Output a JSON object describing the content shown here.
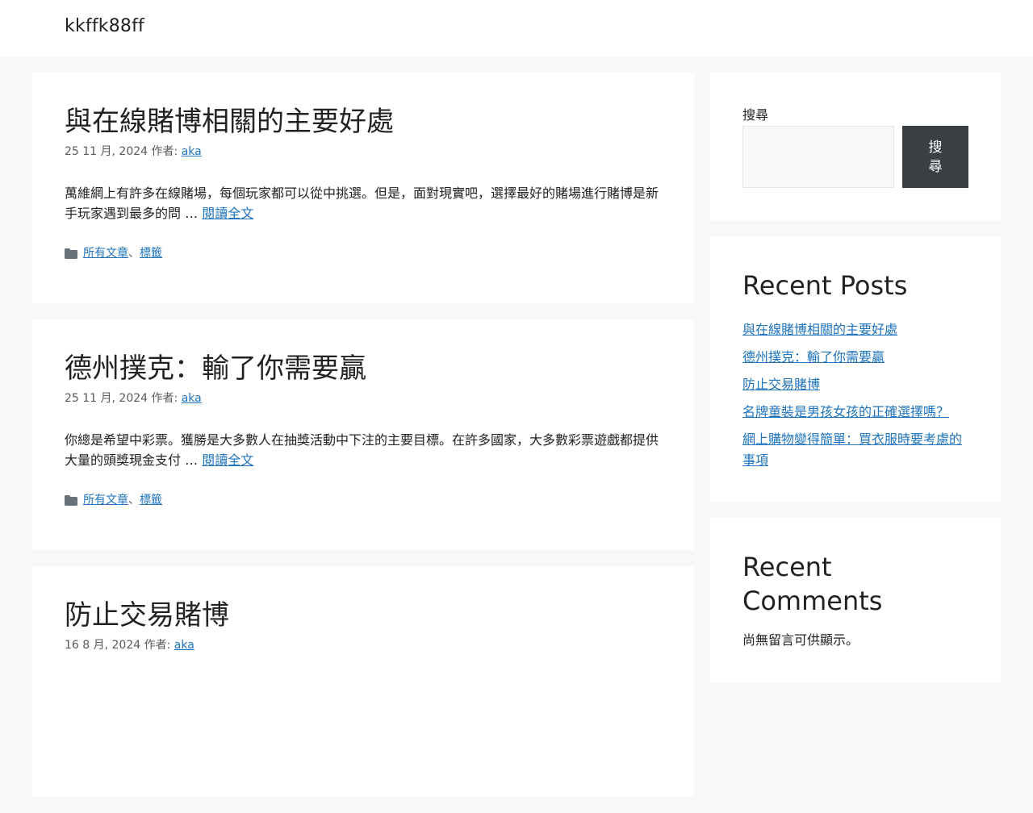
{
  "site": {
    "title": "kkffk88ff"
  },
  "posts": [
    {
      "title": "與在線賭博相關的主要好處",
      "date": "25 11 月, 2024",
      "author_label": "作者:",
      "author": "aka",
      "excerpt": "萬維網上有許多在線賭場，每個玩家都可以從中挑選。但是，面對現實吧，選擇最好的賭場進行賭博是新手玩家遇到最多的問 …",
      "read_more": "閱讀全文",
      "categories": [
        "所有文章",
        "標籤"
      ]
    },
    {
      "title": "德州撲克：輸了你需要贏",
      "date": "25 11 月, 2024",
      "author_label": "作者:",
      "author": "aka",
      "excerpt": "你總是希望中彩票。獲勝是大多數人在抽獎活動中下注的主要目標。在許多國家，大多數彩票遊戲都提供大量的頭獎現金支付 …",
      "read_more": "閱讀全文",
      "categories": [
        "所有文章",
        "標籤"
      ]
    },
    {
      "title": "防止交易賭博",
      "date": "16 8 月, 2024",
      "author_label": "作者:",
      "author": "aka"
    }
  ],
  "category_separator": "、",
  "sidebar": {
    "search": {
      "label": "搜尋",
      "button": "搜尋",
      "placeholder": ""
    },
    "recent_posts": {
      "title": "Recent Posts",
      "items": [
        "與在線賭博相關的主要好處",
        "德州撲克：輸了你需要贏",
        "防止交易賭博",
        "名牌童裝是男孩女孩的正確選擇嗎？",
        "網上購物變得簡單：買衣服時要考慮的事項"
      ]
    },
    "recent_comments": {
      "title": "Recent Comments",
      "empty": "尚無留言可供顯示。"
    }
  },
  "colors": {
    "link": "#1e73be",
    "button_bg": "#3a3f44",
    "page_bg": "#f7f8f9"
  }
}
